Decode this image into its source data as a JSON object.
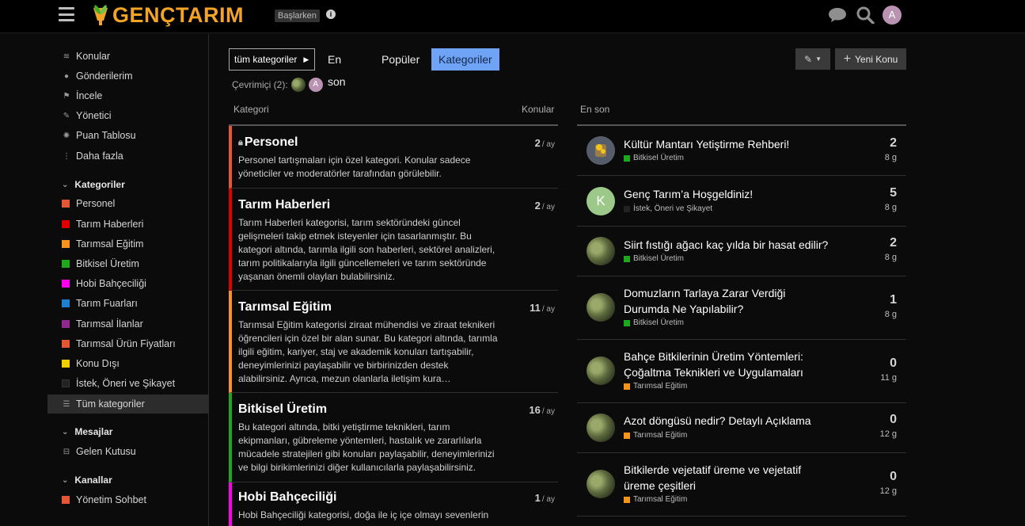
{
  "header": {
    "logo_text": "GENÇTARIM",
    "badge": "Başlarken",
    "avatar_letter": "A",
    "icons": [
      "menu-icon",
      "chat-icon",
      "search-icon"
    ]
  },
  "sidebar": {
    "nav": [
      {
        "label": "Konular",
        "icon": "layers-icon"
      },
      {
        "label": "Gönderilerim",
        "icon": "user-icon"
      },
      {
        "label": "İncele",
        "icon": "flag-icon"
      },
      {
        "label": "Yönetici",
        "icon": "wrench-icon"
      },
      {
        "label": "Puan Tablosu",
        "icon": "gear-icon"
      },
      {
        "label": "Daha fazla",
        "icon": "ellipsis-icon"
      }
    ],
    "categories_header": "Kategoriler",
    "categories": [
      {
        "label": "Personel",
        "color": "#e45735"
      },
      {
        "label": "Tarım Haberleri",
        "color": "#e00000"
      },
      {
        "label": "Tarımsal Eğitim",
        "color": "#f7941d"
      },
      {
        "label": "Bitkisel Üretim",
        "color": "#1ea81e"
      },
      {
        "label": "Hobi Bahçeciliği",
        "color": "#ff00ee"
      },
      {
        "label": "Tarım Fuarları",
        "color": "#1e7fd1"
      },
      {
        "label": "Tarımsal İlanlar",
        "color": "#92278f"
      },
      {
        "label": "Tarımsal Ürün Fiyatları",
        "color": "#e45735"
      },
      {
        "label": "Konu Dışı",
        "color": "#f0d000"
      },
      {
        "label": "İstek, Öneri ve Şikayet",
        "color": "#222222"
      }
    ],
    "all_categories": "Tüm kategoriler",
    "messages_header": "Mesajlar",
    "inbox": "Gelen Kutusu",
    "channels_header": "Kanallar",
    "channel": "Yönetim Sohbet"
  },
  "nav": {
    "dropdown": "tüm kategoriler",
    "links": [
      "En son",
      "Popüler",
      "Kategoriler"
    ],
    "active": "Kategoriler",
    "new_topic": "Yeni Konu"
  },
  "online": "Çevrimiçi (2):",
  "columns": {
    "category": "Kategori",
    "topics": "Konular",
    "latest": "En son"
  },
  "categories": [
    {
      "title": "Personel",
      "locked": true,
      "count": "2",
      "per": "/ ay",
      "color": "#e45735",
      "desc": "Personel tartışmaları için özel kategori. Konular sadece yöneticiler ve moderatörler tarafından görülebilir."
    },
    {
      "title": "Tarım Haberleri",
      "locked": false,
      "count": "2",
      "per": "/ ay",
      "color": "#e00000",
      "desc": "Tarım Haberleri kategorisi, tarım sektöründeki güncel gelişmeleri takip etmek isteyenler için tasarlanmıştır. Bu kategori altında, tarımla ilgili son haberleri, sektörel analizleri, tarım politikalarıyla ilgili güncellemeleri ve tarım sektöründe yaşanan önemli olayları bulabilirsiniz."
    },
    {
      "title": "Tarımsal Eğitim",
      "locked": false,
      "count": "11",
      "per": "/ ay",
      "color": "#f7941d",
      "desc": "Tarımsal Eğitim kategorisi ziraat mühendisi ve ziraat teknikeri öğrencileri için özel bir alan sunar. Bu kategori altında, tarımla ilgili eğitim, kariyer, staj ve akademik konuları tartışabilir, deneyimlerinizi paylaşabilir ve birbirinizden destek alabilirsiniz. Ayrıca, mezun olanlarla iletişim kura…"
    },
    {
      "title": "Bitkisel Üretim",
      "locked": false,
      "count": "16",
      "per": "/ ay",
      "color": "#1ea81e",
      "desc": "Bu kategori altında, bitki yetiştirme teknikleri, tarım ekipmanları, gübreleme yöntemleri, hastalık ve zararlılarla mücadele stratejileri gibi konuları paylaşabilir, deneyimlerinizi ve bilgi birikimlerinizi diğer kullanıcılarla paylaşabilirsiniz."
    },
    {
      "title": "Hobi Bahçeciliği",
      "locked": false,
      "count": "1",
      "per": "/ ay",
      "color": "#ff00ee",
      "desc": "Hobi Bahçeciliği kategorisi, doğa ile iç içe olmayı sevenlerin"
    }
  ],
  "topics": [
    {
      "title": "Kültür Mantarı Yetiştirme Rehberi!",
      "category": "Bitkisel Üretim",
      "cat_color": "#1ea81e",
      "replies": "2",
      "age": "8 g",
      "avatar": "mushroom"
    },
    {
      "title": "Genç Tarım’a Hoşgeldiniz!",
      "category": "İstek, Öneri ve Şikayet",
      "cat_color": "#222222",
      "replies": "5",
      "age": "8 g",
      "avatar": "letter",
      "avatar_letter": "K"
    },
    {
      "title": "Siirt fıstığı ağacı kaç yılda bir hasat edilir?",
      "category": "Bitkisel Üretim",
      "cat_color": "#1ea81e",
      "replies": "2",
      "age": "8 g",
      "avatar": "photo"
    },
    {
      "title": "Domuzların Tarlaya Zarar Verdiği Durumda Ne Yapılabilir?",
      "category": "Bitkisel Üretim",
      "cat_color": "#1ea81e",
      "replies": "1",
      "age": "8 g",
      "avatar": "photo"
    },
    {
      "title": "Bahçe Bitkilerinin Üretim Yöntemleri: Çoğaltma Teknikleri ve Uygulamaları",
      "category": "Tarımsal Eğitim",
      "cat_color": "#f7941d",
      "replies": "0",
      "age": "11 g",
      "avatar": "photo"
    },
    {
      "title": "Azot döngüsü nedir? Detaylı Açıklama",
      "category": "Tarımsal Eğitim",
      "cat_color": "#f7941d",
      "replies": "0",
      "age": "12 g",
      "avatar": "photo"
    },
    {
      "title": "Bitkilerde vejetatif üreme ve vejetatif üreme çeşitleri",
      "category": "Tarımsal Eğitim",
      "cat_color": "#f7941d",
      "replies": "0",
      "age": "12 g",
      "avatar": "photo"
    }
  ]
}
